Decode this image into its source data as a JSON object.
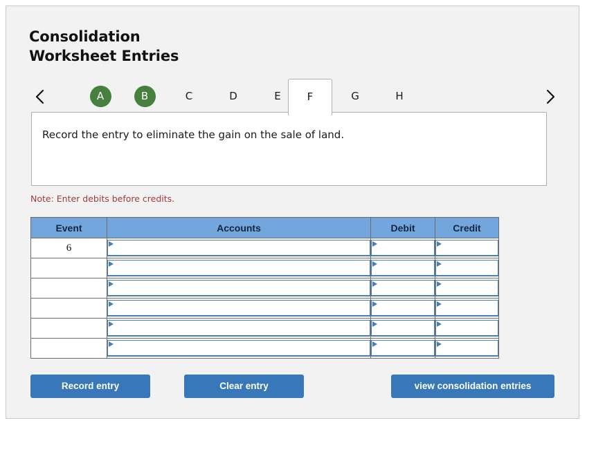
{
  "page": {
    "title_line1": "Consolidation",
    "title_line2": "Worksheet Entries"
  },
  "tabs": {
    "prev_icon": "chevron-left-icon",
    "next_icon": "chevron-right-icon",
    "items": [
      {
        "label": "A",
        "state": "done"
      },
      {
        "label": "B",
        "state": "done"
      },
      {
        "label": "C",
        "state": "normal"
      },
      {
        "label": "D",
        "state": "normal"
      },
      {
        "label": "E",
        "state": "normal"
      },
      {
        "label": "F",
        "state": "active"
      },
      {
        "label": "G",
        "state": "normal"
      },
      {
        "label": "H",
        "state": "normal"
      }
    ],
    "active": "F",
    "done_color": "#45803d"
  },
  "instruction": {
    "text": "Record the entry to eliminate the gain on the sale of land."
  },
  "note": {
    "text": "Note: Enter debits before credits.",
    "color": "#a33a3a"
  },
  "table": {
    "headers": {
      "event": "Event",
      "accounts": "Accounts",
      "debit": "Debit",
      "credit": "Credit"
    },
    "header_color": "#74a6de",
    "rows": [
      {
        "event": "6",
        "accounts": "",
        "debit": "",
        "credit": ""
      },
      {
        "event": "",
        "accounts": "",
        "debit": "",
        "credit": ""
      },
      {
        "event": "",
        "accounts": "",
        "debit": "",
        "credit": ""
      },
      {
        "event": "",
        "accounts": "",
        "debit": "",
        "credit": ""
      },
      {
        "event": "",
        "accounts": "",
        "debit": "",
        "credit": ""
      },
      {
        "event": "",
        "accounts": "",
        "debit": "",
        "credit": ""
      }
    ]
  },
  "buttons": {
    "record": "Record entry",
    "clear": "Clear entry",
    "view": "view consolidation entries",
    "color": "#3878b8"
  }
}
